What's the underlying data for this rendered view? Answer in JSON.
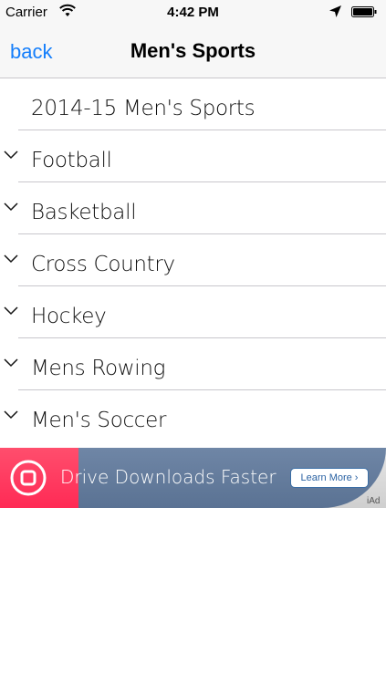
{
  "status_bar": {
    "carrier": "Carrier",
    "time": "4:42 PM",
    "icons": [
      "wifi-icon",
      "location-arrow-icon",
      "battery-icon"
    ]
  },
  "nav": {
    "back_label": "back",
    "title": "Men's Sports"
  },
  "list": {
    "items": [
      {
        "label": "2014-15 Men's Sports",
        "expandable": false
      },
      {
        "label": "Football",
        "expandable": true
      },
      {
        "label": "Basketball",
        "expandable": true
      },
      {
        "label": "Cross Country",
        "expandable": true
      },
      {
        "label": "Hockey",
        "expandable": true
      },
      {
        "label": "Mens Rowing",
        "expandable": true
      },
      {
        "label": "Men's Soccer",
        "expandable": true
      }
    ]
  },
  "ad": {
    "text": "Drive Downloads Faster",
    "button_label": "Learn More ›",
    "badge": "iAd",
    "accent_color": "#ff3b5f"
  },
  "colors": {
    "tint": "#147efb",
    "separator": "#c8c7cc",
    "bar_background": "#f7f7f7"
  }
}
